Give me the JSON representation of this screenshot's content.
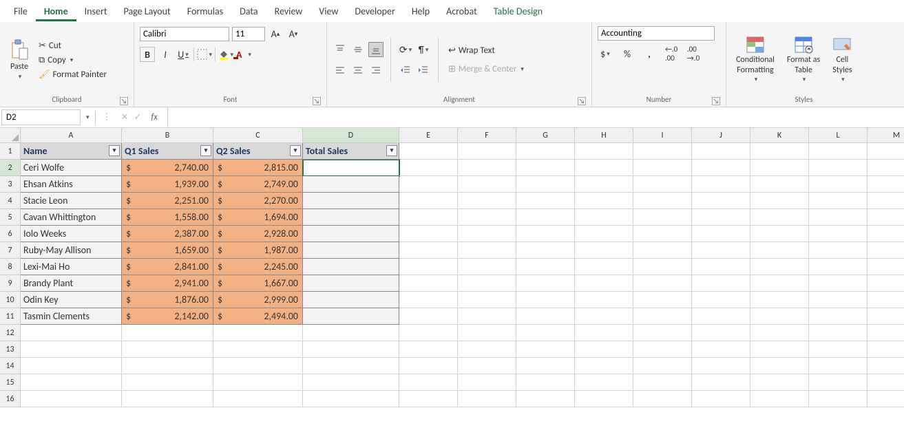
{
  "menu": {
    "tabs": [
      "File",
      "Home",
      "Insert",
      "Page Layout",
      "Formulas",
      "Data",
      "Review",
      "View",
      "Developer",
      "Help",
      "Acrobat",
      "Table Design"
    ],
    "active": "Home"
  },
  "ribbon": {
    "clipboard": {
      "paste": "Paste",
      "cut": "Cut",
      "copy": "Copy",
      "format_painter": "Format Painter",
      "label": "Clipboard"
    },
    "font": {
      "name": "Calibri",
      "size": "11",
      "label": "Font"
    },
    "alignment": {
      "wrap": "Wrap Text",
      "merge": "Merge & Center",
      "label": "Alignment"
    },
    "number": {
      "format": "Accounting",
      "label": "Number"
    },
    "styles": {
      "cond": "Conditional\nFormatting",
      "table": "Format as\nTable",
      "cell": "Cell\nStyles",
      "label": "Styles"
    }
  },
  "namebox": "D2",
  "formula": "",
  "columns": [
    "A",
    "B",
    "C",
    "D",
    "E",
    "F",
    "G",
    "H",
    "I",
    "J",
    "K",
    "L",
    "M"
  ],
  "headers": {
    "name": "Name",
    "q1": "Q1 Sales",
    "q2": "Q2 Sales",
    "total": "Total Sales"
  },
  "rows": [
    {
      "name": "Ceri Wolfe",
      "q1": "2,740.00",
      "q2": "2,815.00"
    },
    {
      "name": "Ehsan Atkins",
      "q1": "1,939.00",
      "q2": "2,749.00"
    },
    {
      "name": "Stacie Leon",
      "q1": "2,251.00",
      "q2": "2,270.00"
    },
    {
      "name": "Cavan Whittington",
      "q1": "1,558.00",
      "q2": "1,694.00"
    },
    {
      "name": "Iolo Weeks",
      "q1": "2,387.00",
      "q2": "2,928.00"
    },
    {
      "name": "Ruby-May Allison",
      "q1": "1,659.00",
      "q2": "1,987.00"
    },
    {
      "name": "Lexi-Mai Ho",
      "q1": "2,841.00",
      "q2": "2,245.00"
    },
    {
      "name": "Brandy Plant",
      "q1": "2,941.00",
      "q2": "1,667.00"
    },
    {
      "name": "Odin Key",
      "q1": "1,876.00",
      "q2": "2,999.00"
    },
    {
      "name": "Tasmin Clements",
      "q1": "2,142.00",
      "q2": "2,494.00"
    }
  ],
  "currency": "$",
  "chart_data": {
    "type": "table",
    "columns": [
      "Name",
      "Q1 Sales",
      "Q2 Sales",
      "Total Sales"
    ],
    "data": [
      [
        "Ceri Wolfe",
        2740.0,
        2815.0,
        null
      ],
      [
        "Ehsan Atkins",
        1939.0,
        2749.0,
        null
      ],
      [
        "Stacie Leon",
        2251.0,
        2270.0,
        null
      ],
      [
        "Cavan Whittington",
        1558.0,
        1694.0,
        null
      ],
      [
        "Iolo Weeks",
        2387.0,
        2928.0,
        null
      ],
      [
        "Ruby-May Allison",
        1659.0,
        1987.0,
        null
      ],
      [
        "Lexi-Mai Ho",
        2841.0,
        2245.0,
        null
      ],
      [
        "Brandy Plant",
        2941.0,
        1667.0,
        null
      ],
      [
        "Odin Key",
        1876.0,
        2999.0,
        null
      ],
      [
        "Tasmin Clements",
        2142.0,
        2494.0,
        null
      ]
    ]
  }
}
